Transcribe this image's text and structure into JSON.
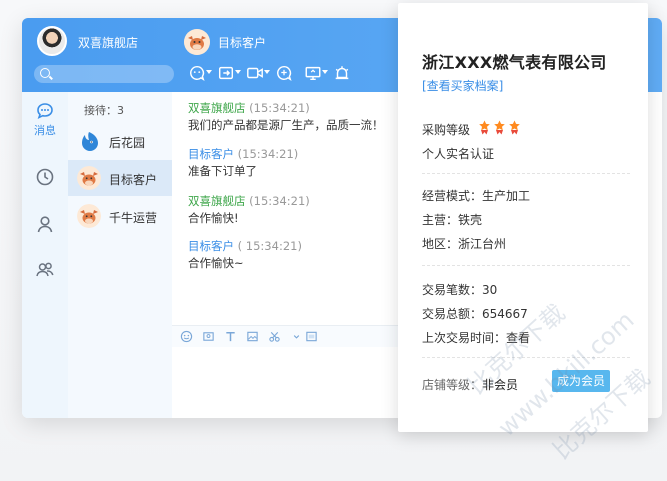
{
  "topbar": {
    "user_name": "双喜旗舰店",
    "contact_name": "目标客户",
    "tools": [
      "emoji-chat-icon",
      "transfer-icon",
      "video-icon",
      "add-emoji-icon",
      "screen-share-icon",
      "alarm-icon"
    ]
  },
  "sidebar": {
    "items": [
      {
        "label": "消息",
        "icon": "message-icon"
      },
      {
        "label": "",
        "icon": "clock-icon"
      },
      {
        "label": "",
        "icon": "user-icon"
      },
      {
        "label": "",
        "icon": "group-icon"
      }
    ]
  },
  "contacts": {
    "waiting_label": "接待：3",
    "items": [
      {
        "name": "后花园",
        "avatar": "bird-avatar"
      },
      {
        "name": "目标客户",
        "avatar": "cow-avatar"
      },
      {
        "name": "千牛运营",
        "avatar": "cow-avatar"
      }
    ]
  },
  "messages": [
    {
      "sender": "双喜旗舰店",
      "time": "(15:34:21)",
      "text": "我们的产品都是源厂生产，品质一流！",
      "side": "shop"
    },
    {
      "sender": "目标客户",
      "time": "(15:34:21)",
      "text": "准备下订单了",
      "side": "customer"
    },
    {
      "sender": "双喜旗舰店",
      "time": "(15:34:21)",
      "text": "合作愉快!",
      "side": "shop"
    },
    {
      "sender": "目标客户",
      "time": "( 15:34:21)",
      "text": "合作愉快~",
      "side": "customer"
    }
  ],
  "input_tools": [
    "smile-icon",
    "image-icon",
    "text-icon",
    "picture-icon",
    "scissors-icon",
    "photo-icon"
  ],
  "card": {
    "company": "浙江XXX燃气表有限公司",
    "profile_link": "[查看买家档案]",
    "buyer_level_label": "采购等级",
    "buyer_level_stars": 3,
    "verified": "个人实名认证",
    "business_mode": "经营模式：生产加工",
    "main_product": "主营：铁壳",
    "region": "地区：浙江台州",
    "trade_count": "交易笔数：30",
    "trade_total": "交易总额：654667",
    "last_trade": "上次交易时间：查看",
    "shop_level_label": "店铺等级：",
    "shop_level_value": "非会员",
    "member_button": "成为会员"
  },
  "colors": {
    "accent": "#4a9cf0",
    "member_button": "#58b7ee",
    "shop_name": "#3ea64a",
    "customer_name": "#3a8ee6"
  }
}
